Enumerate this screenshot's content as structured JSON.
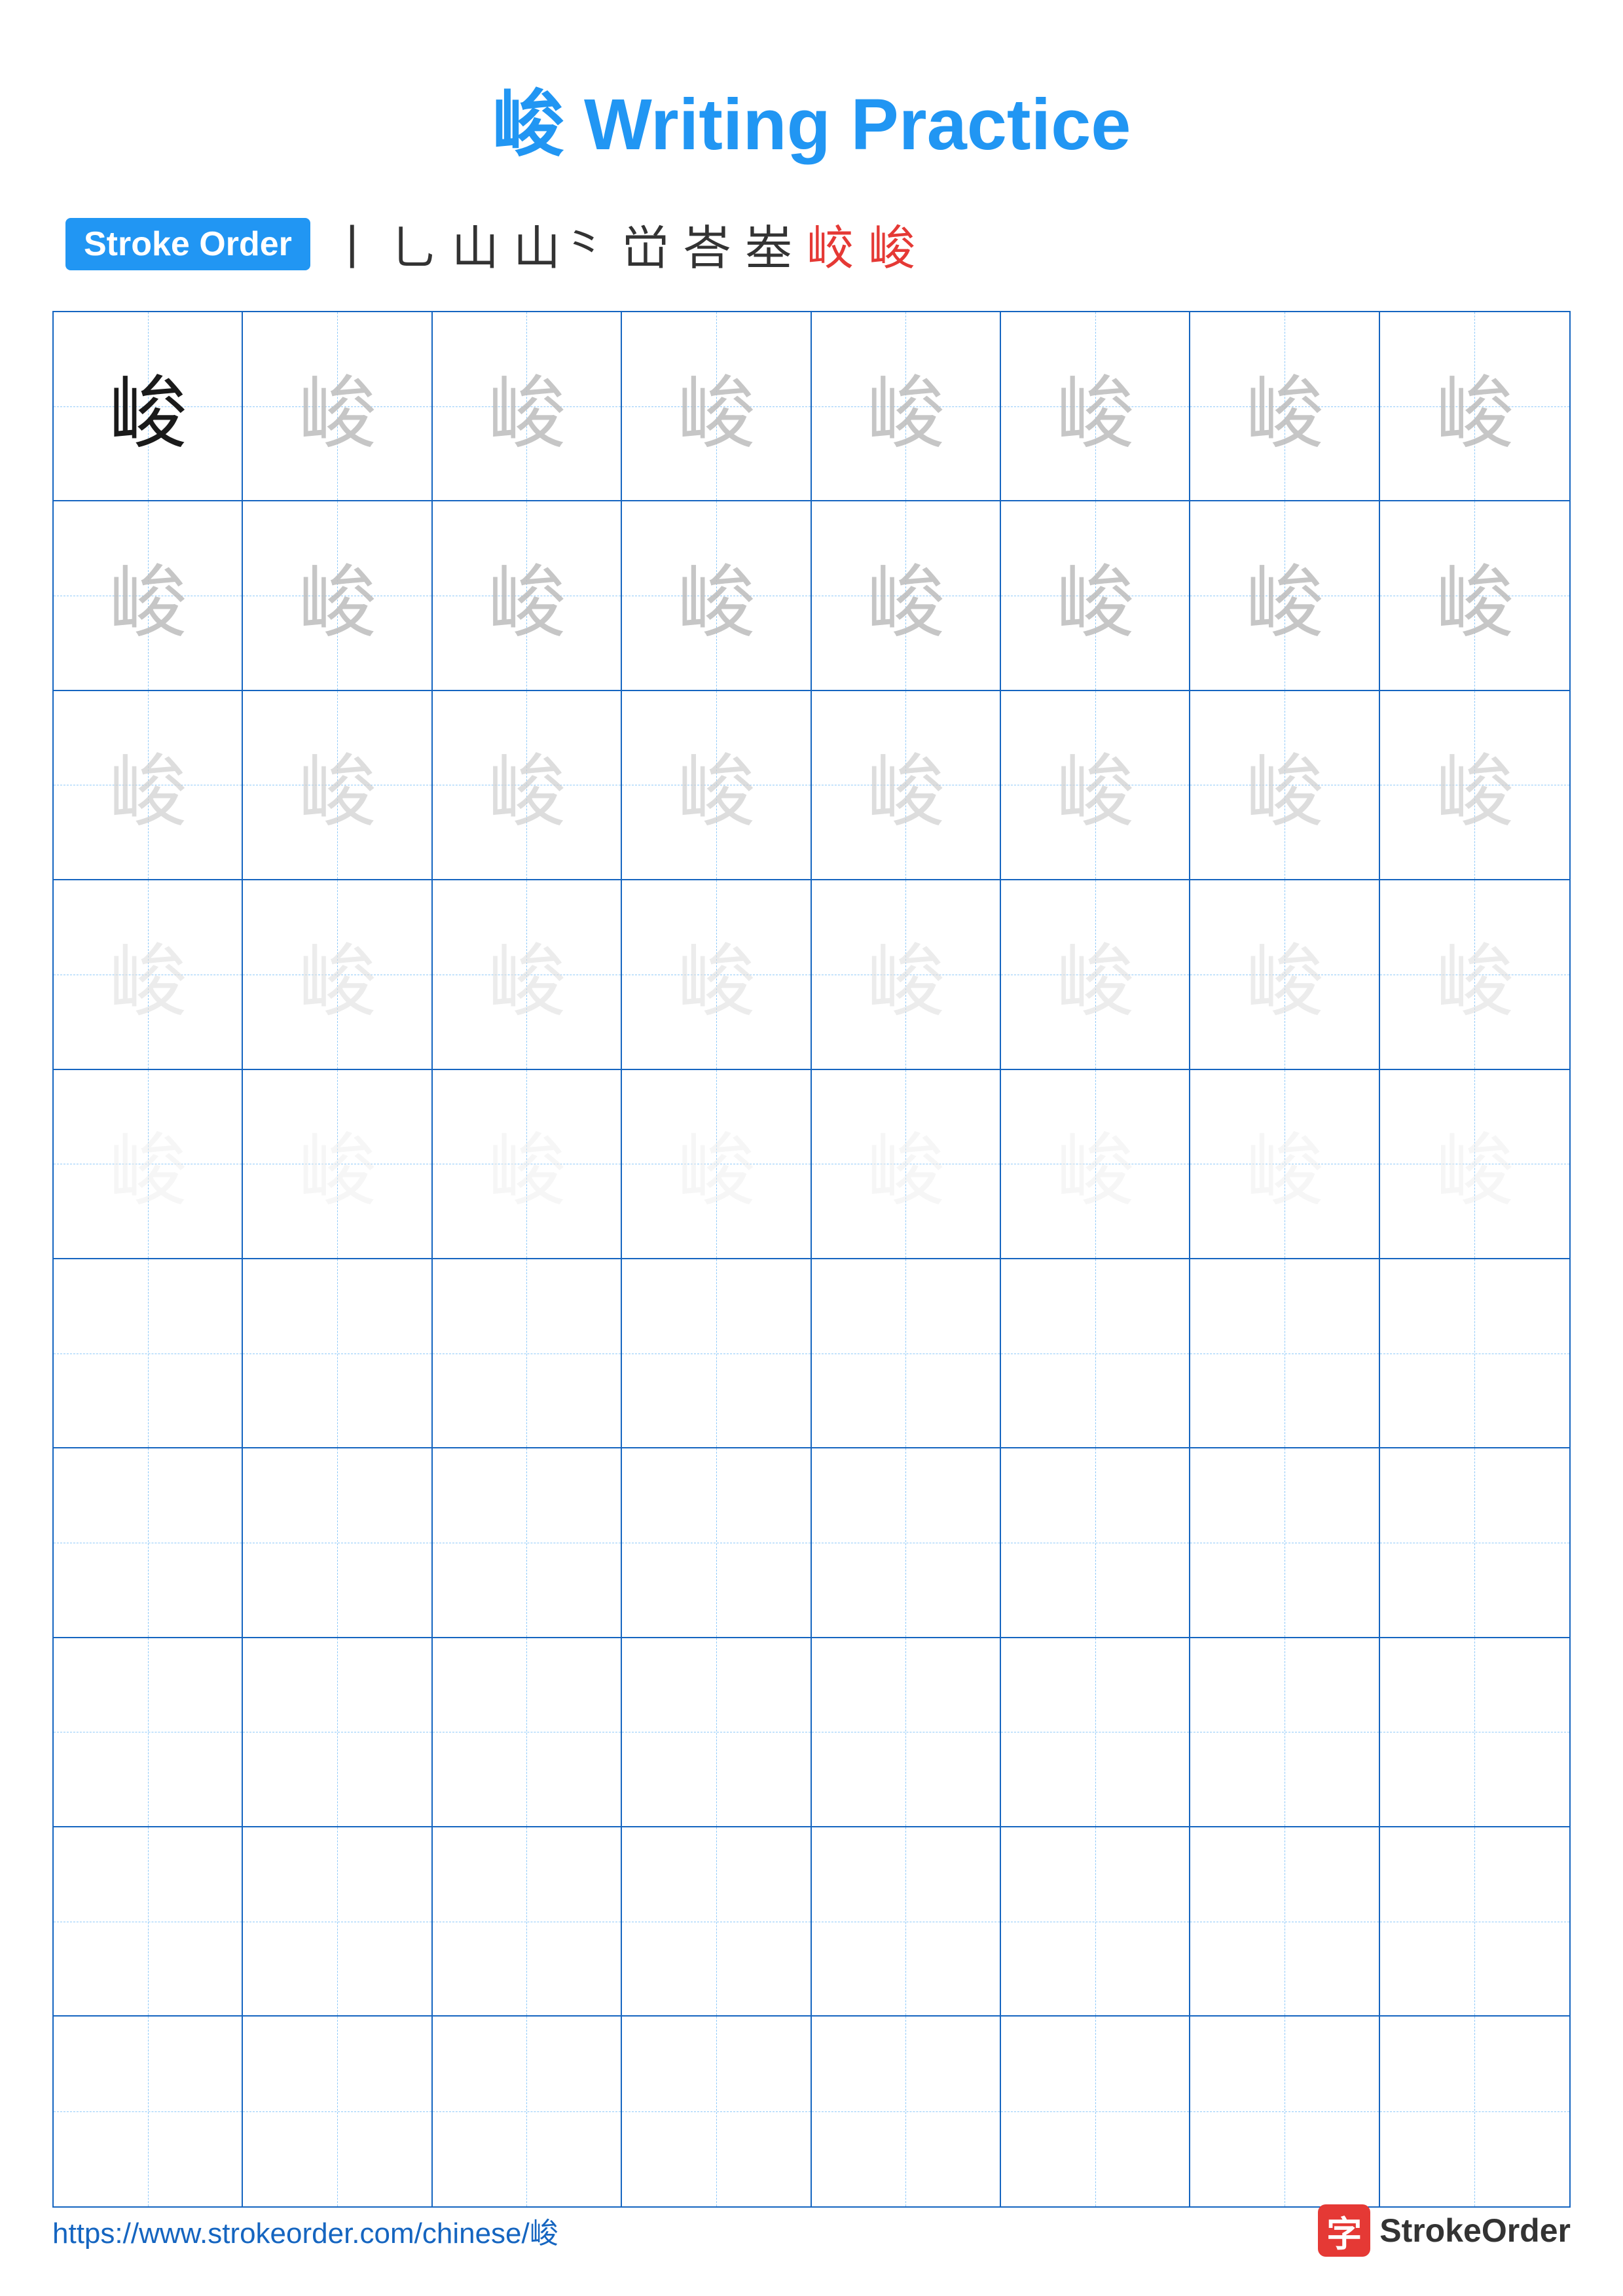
{
  "title": "峻 Writing Practice",
  "stroke_order": {
    "badge_label": "Stroke Order",
    "strokes": [
      "丨",
      "乚",
      "山",
      "山⺀",
      "峃",
      "峇",
      "峚",
      "峧",
      "峻"
    ]
  },
  "character": "峻",
  "grid": {
    "rows": 10,
    "cols": 8,
    "practice_rows": 5,
    "empty_rows": 5
  },
  "footer": {
    "url": "https://www.strokeorder.com/chinese/峻",
    "logo_char": "字",
    "logo_text": "StrokeOrder"
  }
}
